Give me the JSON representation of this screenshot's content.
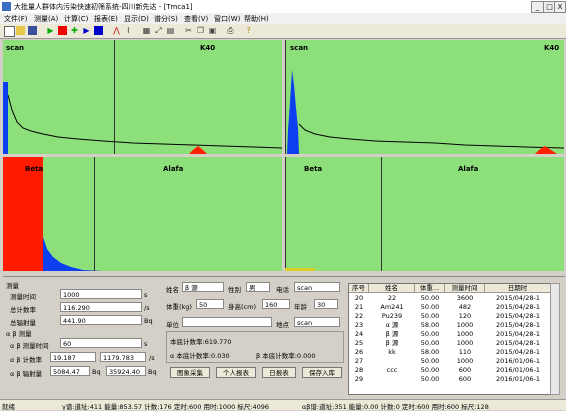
{
  "window": {
    "title": "大批量人群体内污染快速初筛系统-四川新先达 - [Tmca1]",
    "min": "_",
    "max": "□",
    "close": "X"
  },
  "menu": [
    "文件(F)",
    "测量(A)",
    "计算(C)",
    "报表(E)",
    "显示(D)",
    "谱分(S)",
    "查看(V)",
    "窗口(W)",
    "帮助(H)"
  ],
  "toolbar_icons": [
    "new-icon",
    "open-icon",
    "save-icon",
    "start-icon",
    "stop-icon",
    "record-icon",
    "play-icon",
    "pause-icon",
    "peak-icon",
    "spectrum-icon",
    "chart-icon",
    "zoom-icon",
    "grid-icon",
    "cut-icon",
    "copy-icon",
    "paste-icon",
    "print-icon",
    "help-icon"
  ],
  "panels": {
    "top_left": {
      "scan": "scan",
      "k40": "K40"
    },
    "top_right": {
      "scan": "scan",
      "k40": "K40"
    },
    "mid_left": {
      "beta": "Beta",
      "alafa": "Alafa"
    },
    "mid_right": {
      "beta": "Beta",
      "alafa": "Alafa"
    }
  },
  "measure": {
    "group_label": "测量",
    "rows": [
      {
        "label": "测量时间",
        "value": "1000",
        "unit": "s"
      },
      {
        "label": "总计数率",
        "value": "116.290",
        "unit": "/s"
      },
      {
        "label": "总辐射量",
        "value": "441.90",
        "unit": "Bq"
      }
    ],
    "ab_group_label": "α β 测量",
    "ab_time": {
      "label": "α β 测量时间",
      "value": "60",
      "unit": "s"
    },
    "ab_count": {
      "label": "α β 计数率",
      "v1": "19.187",
      "v2": "1179.783",
      "unit": "/s"
    },
    "ab_rad": {
      "label": "α β 辐射量",
      "v1": "5084.47",
      "u1": "Bq",
      "v2": "35924.40",
      "u2": "Bq"
    }
  },
  "person": {
    "name_label": "姓名",
    "name": "β 源",
    "sex_label": "性别",
    "sex": "男",
    "phone_label": "电话",
    "phone": "scan",
    "weight_label": "体重(kg)",
    "weight": "50",
    "height_label": "身高(cm)",
    "height": "160",
    "age_label": "年龄",
    "age": "30",
    "unit_label": "单位",
    "unit": "",
    "place_label": "地点",
    "place": "scan"
  },
  "bg": {
    "bg_rate": "本底计数率:619.770",
    "ab_bg": "α 本底计数率:0.030",
    "b_bg": "β 本底计数率:0.000"
  },
  "buttons": {
    "collect": "图象采集",
    "personal": "个人报表",
    "daily": "日报表",
    "save": "保存入库"
  },
  "table": {
    "headers": [
      "序号",
      "姓名",
      "体重...",
      "测量时间",
      "日期时"
    ],
    "rows": [
      [
        "20",
        "22",
        "50.00",
        "3600",
        "2015/04/28-1"
      ],
      [
        "21",
        "Am241",
        "50.00",
        "482",
        "2015/04/28-1"
      ],
      [
        "22",
        "Pu239",
        "50.00",
        "120",
        "2015/04/28-1"
      ],
      [
        "23",
        "α 源",
        "58.00",
        "1000",
        "2015/04/28-1"
      ],
      [
        "24",
        "β 源",
        "50.00",
        "1000",
        "2015/04/28-1"
      ],
      [
        "25",
        "β 源",
        "50.00",
        "1000",
        "2015/04/28-1"
      ],
      [
        "26",
        "kk",
        "58.00",
        "110",
        "2015/04/28-1"
      ],
      [
        "27",
        "",
        "50.00",
        "1000",
        "2016/01/06-1"
      ],
      [
        "28",
        "ccc",
        "50.00",
        "600",
        "2016/01/06-1"
      ],
      [
        "29",
        "",
        "50.00",
        "600",
        "2016/01/06-1"
      ]
    ]
  },
  "status": {
    "ready": "就绪",
    "left": "γ谱:道址:411 能量:853.57 计数:176 定时:600 用时:1000 标尺:4096",
    "right": "αβ谱:道址:351 能量:0.00 计数:0 定时:600 用时:600 标尺:128"
  },
  "colors": {
    "plot_bg": "#8ddf7a",
    "blue": "#0b3ff0",
    "red": "#ff1a00",
    "curve": "#000000"
  }
}
